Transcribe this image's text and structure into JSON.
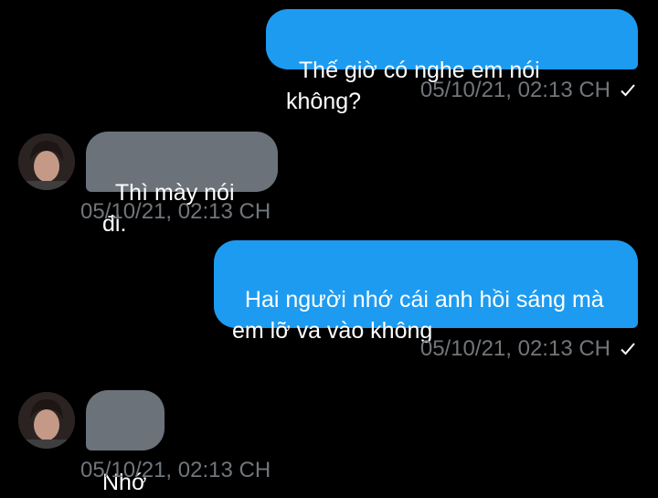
{
  "messages": [
    {
      "direction": "outgoing",
      "text": "Thế giờ có nghe em nói không?",
      "timestamp": "05/10/21, 02:13 CH",
      "status_icon": "check-icon"
    },
    {
      "direction": "incoming",
      "text": "Thì mày nói đi.",
      "timestamp": "05/10/21, 02:13 CH",
      "avatar_icon": "avatar"
    },
    {
      "direction": "outgoing",
      "text": "Hai người nhớ cái anh hồi sáng mà\nem lỡ va vào không",
      "timestamp": "05/10/21, 02:13 CH",
      "status_icon": "check-icon"
    },
    {
      "direction": "incoming",
      "text": "Nhớ",
      "timestamp": "05/10/21, 02:13 CH",
      "avatar_icon": "avatar"
    }
  ],
  "colors": {
    "background": "#000000",
    "outgoing_bubble": "#1d9bf0",
    "incoming_bubble": "#6b727a",
    "timestamp": "#71767b",
    "text": "#ffffff"
  }
}
